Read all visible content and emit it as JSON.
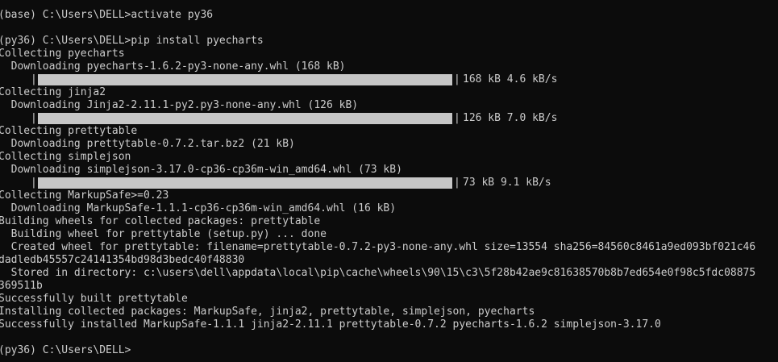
{
  "terminal": {
    "lines": [
      "(base) C:\\Users\\DELL>activate py36",
      "",
      "(py36) C:\\Users\\DELL>pip install pyecharts",
      "Collecting pyecharts",
      "  Downloading pyecharts-1.6.2-py3-none-any.whl (168 kB)",
      "",
      "Collecting jinja2",
      "  Downloading Jinja2-2.11.1-py2.py3-none-any.whl (126 kB)",
      "",
      "Collecting prettytable",
      "  Downloading prettytable-0.7.2.tar.bz2 (21 kB)",
      "Collecting simplejson",
      "  Downloading simplejson-3.17.0-cp36-cp36m-win_amd64.whl (73 kB)",
      "",
      "Collecting MarkupSafe>=0.23",
      "  Downloading MarkupSafe-1.1.1-cp36-cp36m-win_amd64.whl (16 kB)",
      "Building wheels for collected packages: prettytable",
      "  Building wheel for prettytable (setup.py) ... done",
      "  Created wheel for prettytable: filename=prettytable-0.7.2-py3-none-any.whl size=13554 sha256=84560c8461a9ed093bf021c46",
      "dadledb45557c24141354bd98d3bedc40f48830",
      "  Stored in directory: c:\\users\\dell\\appdata\\local\\pip\\cache\\wheels\\90\\15\\c3\\5f28b42ae9c81638570b8b7ed654e0f98c5fdc08875",
      "369511b",
      "Successfully built prettytable",
      "Installing collected packages: MarkupSafe, jinja2, prettytable, simplejson, pyecharts",
      "Successfully installed MarkupSafe-1.1.1 jinja2-2.11.1 prettytable-0.7.2 pyecharts-1.6.2 simplejson-3.17.0",
      "",
      "(py36) C:\\Users\\DELL>"
    ],
    "progress_bars": [
      {
        "left_edge": "|",
        "right_edge": "|",
        "progress": 1.0,
        "stats": "168 kB 4.6 kB/s"
      },
      {
        "left_edge": "|",
        "right_edge": "|",
        "progress": 1.0,
        "stats": "126 kB 7.0 kB/s"
      },
      {
        "left_edge": "|",
        "right_edge": "|",
        "progress": 1.0,
        "stats": "73 kB 9.1 kB/s"
      }
    ],
    "colors": {
      "background": "#0c0c0c",
      "text": "#cccccc",
      "bar_fill": "#c6c6c6"
    }
  }
}
